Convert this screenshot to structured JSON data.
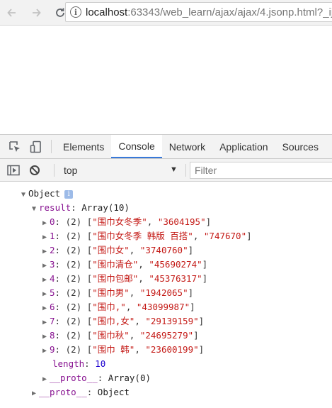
{
  "browser": {
    "url_host": "localhost",
    "url_rest": ":63343/web_learn/ajax/ajax/4.jsonp.html?_ij"
  },
  "devtools": {
    "tabs": [
      {
        "label": "Elements",
        "active": false
      },
      {
        "label": "Console",
        "active": true
      },
      {
        "label": "Network",
        "active": false
      },
      {
        "label": "Application",
        "active": false
      },
      {
        "label": "Sources",
        "active": false
      }
    ],
    "context": "top",
    "filter_placeholder": "Filter"
  },
  "console": {
    "object_label": "Object",
    "result_key": "result",
    "result_type": "Array(10)",
    "items": [
      {
        "index": "0",
        "len": "(2)",
        "name": "\"围巾女冬季\"",
        "id": "\"3604195\""
      },
      {
        "index": "1",
        "len": "(2)",
        "name": "\"围巾女冬季 韩版 百搭\"",
        "id": "\"747670\""
      },
      {
        "index": "2",
        "len": "(2)",
        "name": "\"围巾女\"",
        "id": "\"3740760\""
      },
      {
        "index": "3",
        "len": "(2)",
        "name": "\"围巾清仓\"",
        "id": "\"45690274\""
      },
      {
        "index": "4",
        "len": "(2)",
        "name": "\"围巾包邮\"",
        "id": "\"45376317\""
      },
      {
        "index": "5",
        "len": "(2)",
        "name": "\"围巾男\"",
        "id": "\"1942065\""
      },
      {
        "index": "6",
        "len": "(2)",
        "name": "\"围巾,\"",
        "id": "\"43099987\""
      },
      {
        "index": "7",
        "len": "(2)",
        "name": "\"围巾,女\"",
        "id": "\"29139159\""
      },
      {
        "index": "8",
        "len": "(2)",
        "name": "\"围巾秋\"",
        "id": "\"24695279\""
      },
      {
        "index": "9",
        "len": "(2)",
        "name": "\"围巾 韩\"",
        "id": "\"23600199\""
      }
    ],
    "length_key": "length",
    "length_value": "10",
    "proto_key": "__proto__",
    "array_proto_value": "Array(0)",
    "object_proto_value": "Object"
  },
  "colors": {
    "key": "#881391",
    "string": "#c41a16",
    "number": "#1c00cf",
    "active_tab_underline": "#3879d9"
  }
}
